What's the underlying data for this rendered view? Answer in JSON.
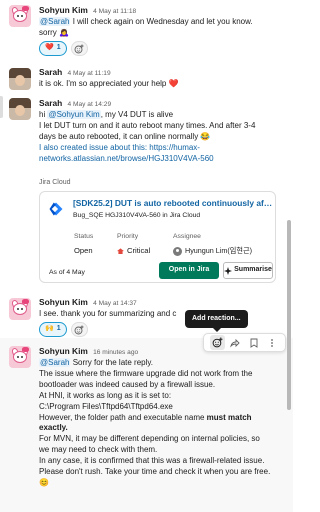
{
  "messages": [
    {
      "author": "Sohyun Kim",
      "time": "4 May at 11:18",
      "mention": "@Sarah",
      "text_after_mention": " I will check again on Wednesday and let you know.",
      "text_line2": "sorry 🙇‍♀️",
      "reaction": {
        "emoji": "❤️",
        "count": "1"
      }
    },
    {
      "author": "Sarah",
      "time": "4 May at 11:19",
      "text": "it is ok. I'm so appreciated your help ❤️"
    },
    {
      "author": "Sarah",
      "time": "4 May at 14:29",
      "line1_prefix": "hi ",
      "mention": "@Sohyun Kim",
      "line1_suffix": ", my V4 DUT is alive",
      "line2": "I let DUT turn on and it auto reboot many times. And after 3-4",
      "line3": "days be auto rebooted, it can online normally 😂",
      "line4": "I also created issue about this: https://humax-",
      "line5": "networks.atlassian.net/browse/HGJ310V4VA-560",
      "card": {
        "source": "Jira Cloud",
        "title": "[SDK25.2] DUT is auto rebooted continuously afte...",
        "subtitle": "Bug_SQE HGJ310V4VA-560 in Jira Cloud",
        "status_label": "Status",
        "status_value": "Open",
        "priority_label": "Priority",
        "priority_value": "Critical",
        "assignee_label": "Assignee",
        "assignee_value": "Hyungun Lim(임현근)",
        "as_of": "As of 4 May",
        "open_button": "Open in Jira",
        "summarise_button": "Summarise"
      }
    },
    {
      "author": "Sohyun Kim",
      "time": "4 May at 14:37",
      "text": "I see. thank you for summarizing and c",
      "reaction": {
        "emoji": "🙌",
        "count": "1"
      }
    },
    {
      "author": "Sohyun Kim",
      "time": "16 minutes ago",
      "mention": "@Sarah",
      "line1_suffix": " Sorry for the late reply.",
      "line2": "The issue where the firmware upgrade did not work from the",
      "line3": "bootloader was indeed caused by a firewall issue.",
      "line4": "At HNI, it works as long as it is set to:",
      "line5": "C:\\Program Files\\Tftpd64\\Tftpd64.exe",
      "line6_prefix": "However, the folder path and executable name ",
      "line6_bold": "must match",
      "line7_bold": "exactly.",
      "line8": "For MVN, it may be different depending on internal policies, so",
      "line9": "we may need to check with them.",
      "line10": "In any case, it is confirmed that this was a firewall-related issue.",
      "line11": "Please don't rush. Take your time and check it when you are free.",
      "line12": "😊"
    }
  ],
  "tooltip": "Add reaction...",
  "icons": {
    "add_reaction": "add-reaction-icon",
    "share": "share-icon",
    "bookmark": "bookmark-icon",
    "more": "more-icon"
  },
  "colors": {
    "link": "#1264a3",
    "primary_button": "#007a5a",
    "heart": "#e01e5a"
  }
}
